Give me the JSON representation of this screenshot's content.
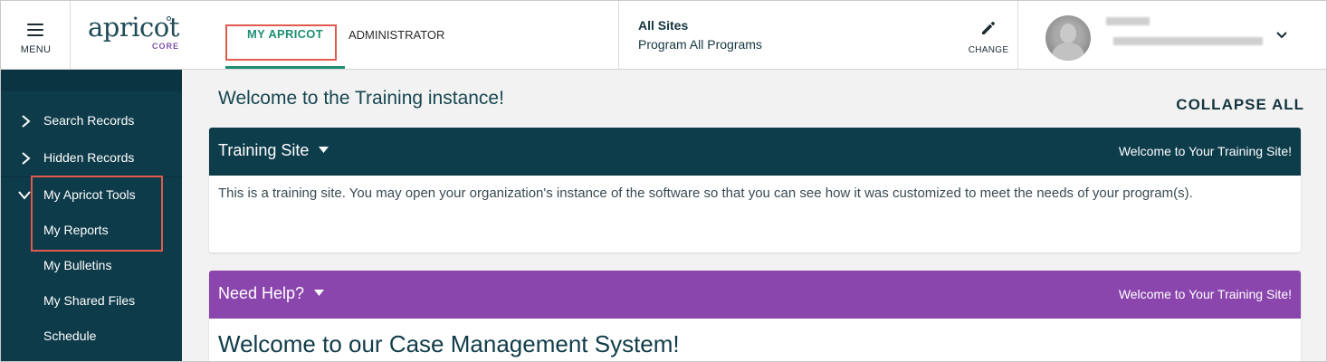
{
  "header": {
    "menu_label": "MENU",
    "logo_word": "apricot",
    "logo_sub": "CORE",
    "tabs": [
      {
        "label": "MY APRICOT",
        "active": true
      },
      {
        "label": "ADMINISTRATOR",
        "active": false
      }
    ],
    "site": {
      "title": "All Sites",
      "program": "Program All Programs",
      "change_label": "CHANGE"
    }
  },
  "sidebar": {
    "items": [
      {
        "label": "Search Records",
        "icon": "chevron-right-icon"
      },
      {
        "label": "Hidden Records",
        "icon": "chevron-right-icon"
      },
      {
        "label": "My Apricot Tools",
        "icon": "chevron-down-icon"
      },
      {
        "label": "My Reports"
      },
      {
        "label": "My Bulletins"
      },
      {
        "label": "My Shared Files"
      },
      {
        "label": "Schedule"
      }
    ]
  },
  "main": {
    "welcome": "Welcome to the Training instance!",
    "collapse_all": "COLLAPSE ALL",
    "cards": [
      {
        "title": "Training Site",
        "right_text": "Welcome to Your Training Site!",
        "body": "This is a training site. You may open your organization's instance of the software so that you can see how it was customized to meet the needs of your program(s).",
        "color": "#0d3c4a"
      },
      {
        "title": "Need Help?",
        "right_text": "Welcome to Your Training Site!",
        "heading": "Welcome to our Case Management System!",
        "color": "#8b46ad"
      }
    ]
  },
  "colors": {
    "accent_green": "#1f8f73",
    "highlight_red": "#e05a4e",
    "sidebar_bg": "#0e3b4a"
  }
}
